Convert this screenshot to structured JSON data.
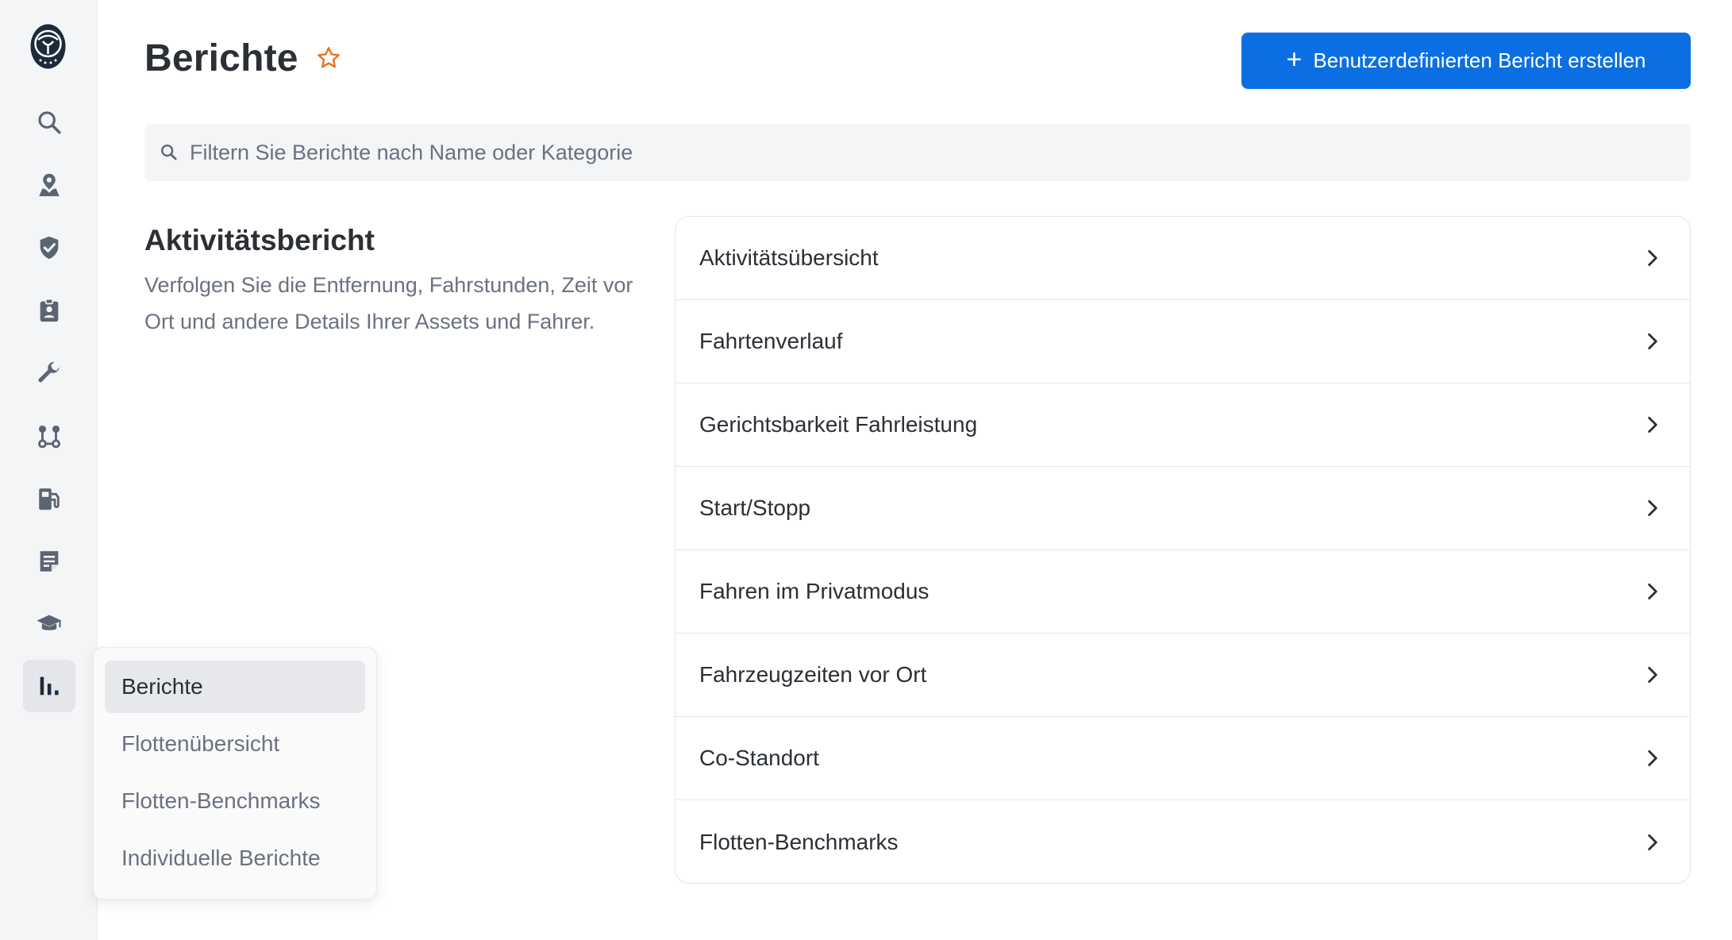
{
  "header": {
    "title": "Berichte",
    "create_button_label": "Benutzerdefinierten Bericht erstellen"
  },
  "search": {
    "placeholder": "Filtern Sie Berichte nach Name oder Kategorie",
    "value": ""
  },
  "section": {
    "title": "Aktivitätsbericht",
    "description": "Verfolgen Sie die Entfernung, Fahrstunden, Zeit vor Ort und andere Details Ihrer Assets und Fahrer."
  },
  "reports": [
    {
      "label": "Aktivitätsübersicht"
    },
    {
      "label": "Fahrtenverlauf"
    },
    {
      "label": "Gerichtsbarkeit Fahrleistung"
    },
    {
      "label": "Start/Stopp"
    },
    {
      "label": "Fahren im Privatmodus"
    },
    {
      "label": "Fahrzeugzeiten vor Ort"
    },
    {
      "label": "Co-Standort"
    },
    {
      "label": "Flotten-Benchmarks"
    }
  ],
  "flyout": {
    "items": [
      {
        "label": "Berichte",
        "active": true
      },
      {
        "label": "Flottenübersicht",
        "active": false
      },
      {
        "label": "Flotten-Benchmarks",
        "active": false
      },
      {
        "label": "Individuelle Berichte",
        "active": false
      }
    ]
  },
  "sidebar": {
    "icons": [
      "logo-owl-icon",
      "search-icon",
      "map-pin-icon",
      "shield-check-icon",
      "clipboard-badge-icon",
      "wrench-icon",
      "route-icon",
      "fuel-icon",
      "document-icon",
      "graduation-cap-icon",
      "bar-chart-icon"
    ]
  },
  "colors": {
    "primary": "#0b6fe3",
    "star": "#e8731c",
    "text_primary": "#2b2f36",
    "text_secondary": "#6a7280",
    "icon": "#5b6472",
    "rail_bg": "#f4f5f7"
  }
}
